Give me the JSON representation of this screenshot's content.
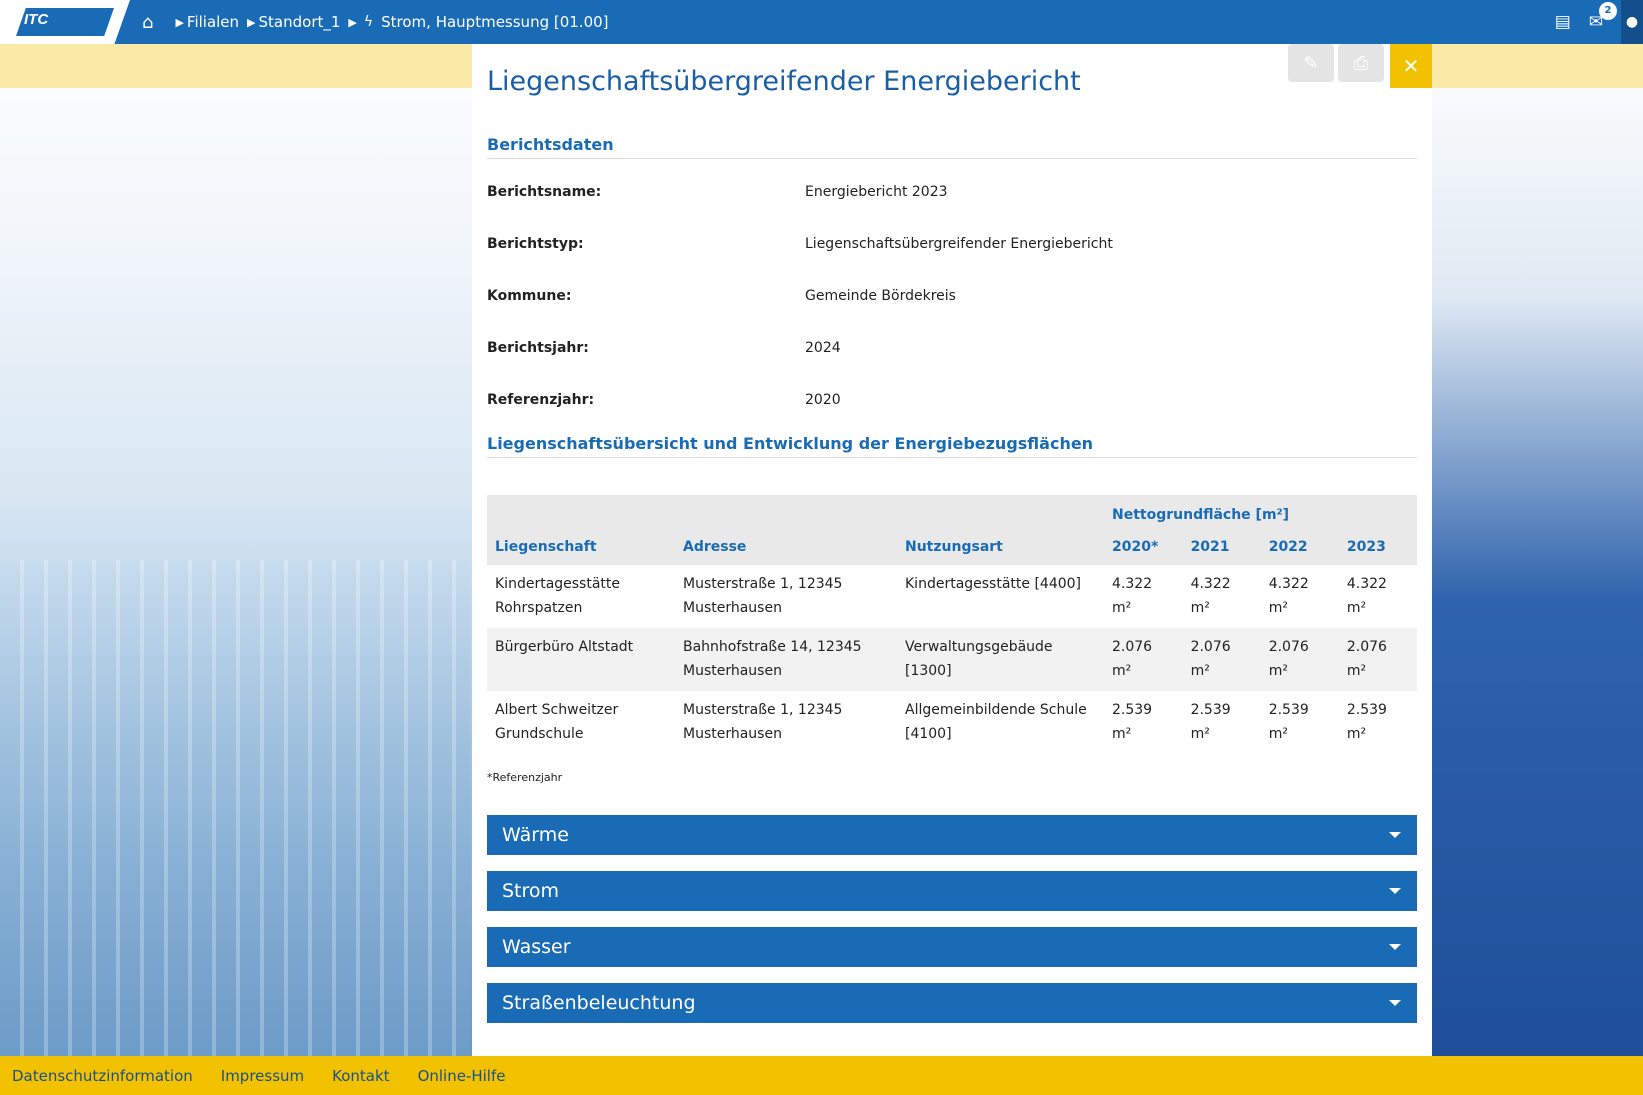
{
  "header": {
    "logo_text": "ITC",
    "breadcrumb": [
      "Filialen",
      "Standort_1",
      "Strom, Hauptmessung [01.00]"
    ],
    "notification_count": "2"
  },
  "report": {
    "title": "Liegenschaftsübergreifender Energiebericht",
    "section1_title": "Berichtsdaten",
    "fields": [
      {
        "label": "Berichtsname:",
        "value": "Energiebericht 2023"
      },
      {
        "label": "Berichtstyp:",
        "value": "Liegenschaftsübergreifender Energiebericht"
      },
      {
        "label": "Kommune:",
        "value": "Gemeinde Bördekreis"
      },
      {
        "label": "Berichtsjahr:",
        "value": "2024"
      },
      {
        "label": "Referenzjahr:",
        "value": "2020"
      }
    ],
    "section2_title": "Liegenschaftsübersicht und Entwicklung der Energiebezugsflächen",
    "table": {
      "group_header": "Nettogrundfläche [m²]",
      "columns": [
        "Liegenschaft",
        "Adresse",
        "Nutzungsart",
        "2020*",
        "2021",
        "2022",
        "2023"
      ],
      "rows": [
        [
          "Kindertagesstätte Rohrspatzen",
          "Musterstraße 1, 12345 Musterhausen",
          "Kindertagesstätte [4400]",
          "4.322 m²",
          "4.322 m²",
          "4.322 m²",
          "4.322 m²"
        ],
        [
          "Bürgerbüro Altstadt",
          "Bahnhofstraße 14, 12345 Musterhausen",
          "Verwaltungsgebäude [1300]",
          "2.076 m²",
          "2.076 m²",
          "2.076 m²",
          "2.076 m²"
        ],
        [
          "Albert Schweitzer Grundschule",
          "Musterstraße 1, 12345 Musterhausen",
          "Allgemeinbildende Schule [4100]",
          "2.539 m²",
          "2.539 m²",
          "2.539 m²",
          "2.539 m²"
        ]
      ],
      "footnote": "*Referenzjahr"
    },
    "accordions": [
      "Wärme",
      "Strom",
      "Wasser",
      "Straßenbeleuchtung"
    ]
  },
  "footer": {
    "links": [
      "Datenschutzinformation",
      "Impressum",
      "Kontakt",
      "Online-Hilfe"
    ]
  },
  "colors": {
    "primary": "#1a6bb5",
    "accent_yellow": "#f2c200",
    "light_yellow": "#fbe9a8"
  },
  "icons": [
    "home-icon",
    "bolt-icon",
    "edit-icon",
    "print-icon",
    "close-icon",
    "clipboard-icon",
    "mail-icon",
    "user-icon",
    "chevron-down-icon"
  ]
}
